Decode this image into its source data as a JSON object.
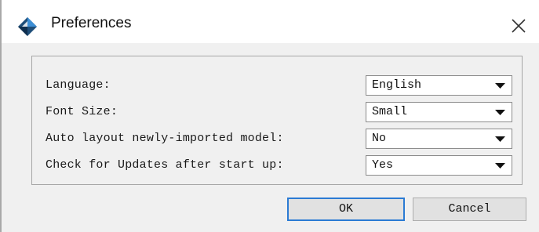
{
  "window": {
    "title": "Preferences",
    "icon": "app-diamond-icon",
    "close_icon": "close-icon"
  },
  "settings": [
    {
      "label": "Language:",
      "value": "English"
    },
    {
      "label": "Font Size:",
      "value": "Small"
    },
    {
      "label": "Auto layout newly-imported model:",
      "value": "No"
    },
    {
      "label": "Check for Updates after start up:",
      "value": "Yes"
    }
  ],
  "buttons": {
    "ok_label": "OK",
    "cancel_label": "Cancel"
  },
  "colors": {
    "dialog_background": "#f0f0f0",
    "default_button_border": "#2b7bd4"
  }
}
